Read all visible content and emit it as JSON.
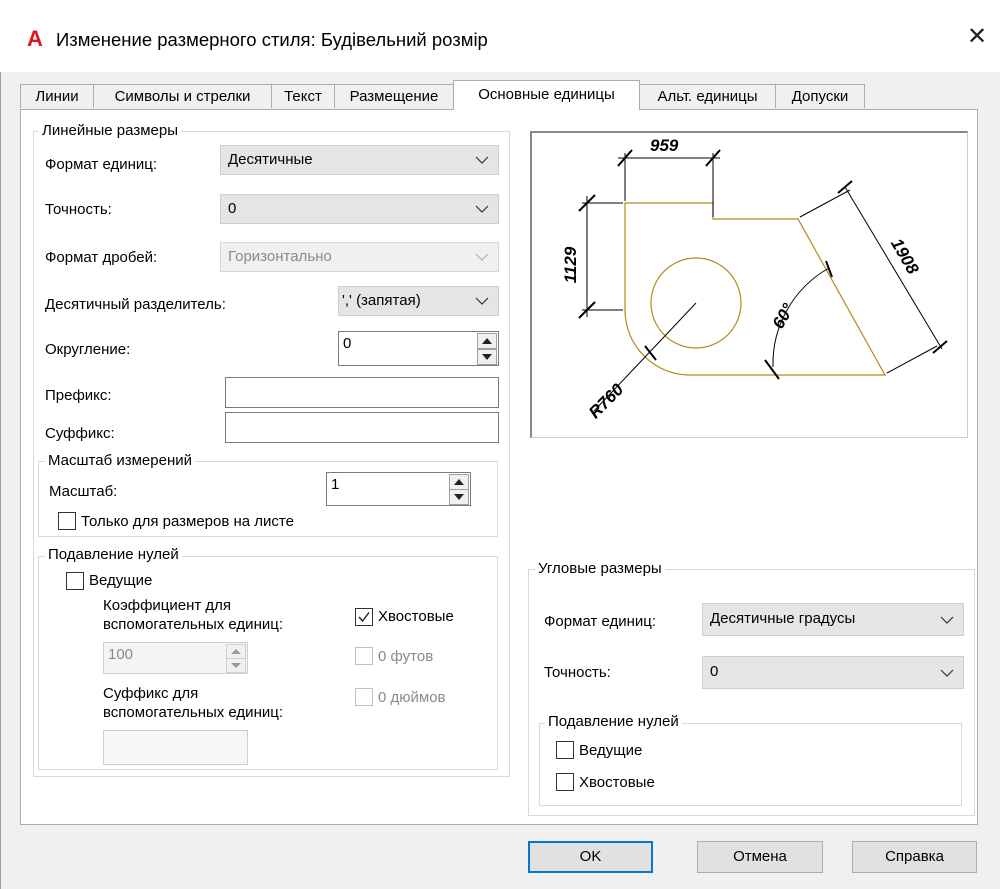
{
  "window": {
    "logo": "A",
    "title": "Изменение размерного стиля: Будівельний розмір"
  },
  "tabs": [
    {
      "label": "Линии"
    },
    {
      "label": "Символы и стрелки"
    },
    {
      "label": "Текст"
    },
    {
      "label": "Размещение"
    },
    {
      "label": "Основные единицы"
    },
    {
      "label": "Альт. единицы"
    },
    {
      "label": "Допуски"
    }
  ],
  "active_tab": "Основные единицы",
  "linear": {
    "group_label": "Линейные размеры",
    "unit_format_label": "Формат единиц:",
    "unit_format_value": "Десятичные",
    "precision_label": "Точность:",
    "precision_value": "0",
    "fraction_format_label": "Формат дробей:",
    "fraction_format_value": "Горизонтально",
    "decimal_separator_label": "Десятичный  разделитель:",
    "decimal_separator_value": "',' (запятая)",
    "roundoff_label": "Округление:",
    "roundoff_value": "0",
    "prefix_label": "Префикс:",
    "prefix_value": "",
    "suffix_label": "Суффикс:",
    "suffix_value": ""
  },
  "measurement_scale": {
    "group_label": "Масштаб измерений",
    "scale_label": "Масштаб:",
    "scale_value": "1",
    "layout_only_label": "Только для размеров на листе",
    "layout_only_checked": false
  },
  "zero_suppression_linear": {
    "group_label": "Подавление нулей",
    "leading_label": "Ведущие",
    "leading_checked": false,
    "subunit_factor_label_line1": "Коэффициент для",
    "subunit_factor_label_line2": "вспомогательных единиц:",
    "subunit_factor_value": "100",
    "trailing_label": "Хвостовые",
    "trailing_checked": true,
    "zero_feet_label": "0 футов",
    "zero_inches_label": "0 дюймов",
    "subunit_suffix_label_line1": "Суффикс для",
    "subunit_suffix_label_line2": "вспомогательных единиц:",
    "subunit_suffix_value": ""
  },
  "angular": {
    "group_label": "Угловые размеры",
    "unit_format_label": "Формат единиц:",
    "unit_format_value": "Десятичные градусы",
    "precision_label": "Точность:",
    "precision_value": "0",
    "zero_group_label": "Подавление нулей",
    "leading_label": "Ведущие",
    "leading_checked": false,
    "trailing_label": "Хвостовые",
    "trailing_checked": false
  },
  "preview": {
    "dim_top": "959",
    "dim_left": "1129",
    "dim_right": "1908",
    "dim_angle": "60°",
    "dim_radius": "R760"
  },
  "buttons": {
    "ok": "OK",
    "cancel": "Отмена",
    "help": "Справка"
  },
  "colors": {
    "accent": "#0078d7",
    "logo": "#e0171c",
    "preview_geometry": "#b58a1a"
  }
}
